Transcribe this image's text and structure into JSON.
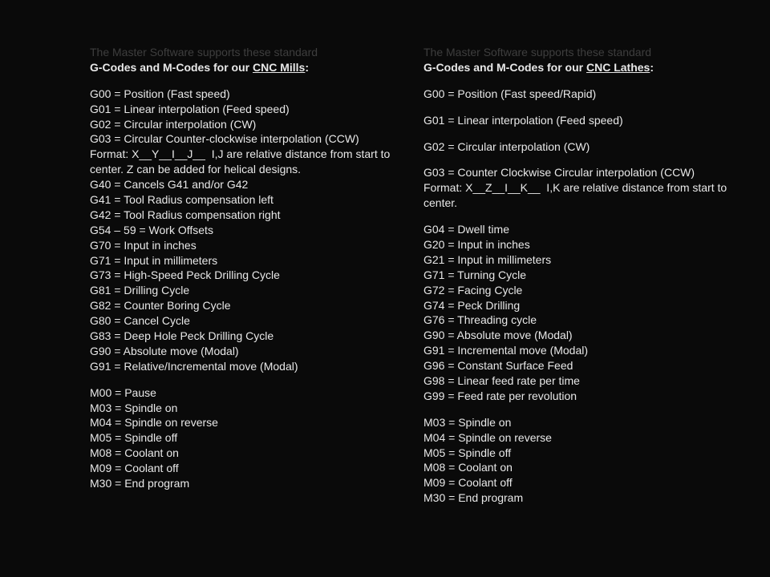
{
  "left": {
    "intro_dim": "The Master Software supports these standard",
    "intro_bold_pre": "G-Codes and M-Codes for our ",
    "intro_bold_ul": "CNC Mills",
    "intro_bold_post": ":",
    "gcodes": [
      "G00 = Position (Fast speed)",
      "G01 = Linear interpolation (Feed speed)",
      "G02 = Circular interpolation (CW)",
      "G03 = Circular Counter-clockwise interpolation (CCW)",
      "Format: X__Y__I__J__  I,J are relative distance from start to center. Z can be added for helical designs.",
      "G40 = Cancels G41 and/or G42",
      "G41 = Tool Radius compensation left",
      "G42 = Tool Radius compensation right",
      "G54 – 59 = Work Offsets",
      "G70 = Input in inches",
      "G71 = Input in millimeters",
      "G73 = High-Speed Peck Drilling Cycle",
      "G81 = Drilling Cycle",
      "G82 = Counter Boring Cycle",
      "G80 = Cancel Cycle",
      "G83 = Deep Hole Peck Drilling Cycle",
      "G90 = Absolute move (Modal)",
      "G91 = Relative/Incremental move (Modal)"
    ],
    "mcodes": [
      "M00 = Pause",
      "M03 = Spindle on",
      "M04 = Spindle on reverse",
      "M05 = Spindle off",
      "M08 = Coolant on",
      "M09 = Coolant off",
      "M30 = End program"
    ]
  },
  "right": {
    "intro_dim": "The Master Software supports these standard",
    "intro_bold_pre": "G-Codes and M-Codes for our ",
    "intro_bold_ul": "CNC Lathes",
    "intro_bold_post": ":",
    "g00": "G00 = Position (Fast speed/Rapid)",
    "g01": "G01 = Linear interpolation (Feed speed)",
    "g02": "G02 = Circular interpolation (CW)",
    "g03a": "G03 = Counter Clockwise Circular interpolation (CCW)",
    "g03b": "Format: X__Z__I__K__  I,K are relative distance from start to center.",
    "grest": [
      "G04 = Dwell time",
      "G20 = Input in inches",
      "G21 = Input in millimeters",
      "G71 = Turning Cycle",
      "G72 = Facing Cycle",
      "G74 = Peck Drilling",
      "G76 = Threading cycle",
      "G90 = Absolute move (Modal)",
      "G91 = Incremental move (Modal)",
      "G96 = Constant Surface Feed",
      "G98 = Linear feed rate per time",
      "G99 = Feed rate per revolution"
    ],
    "mcodes": [
      "M03 = Spindle on",
      "M04 = Spindle on reverse",
      "M05 = Spindle off",
      "M08 = Coolant on",
      "M09 = Coolant off",
      "M30 = End program"
    ]
  }
}
